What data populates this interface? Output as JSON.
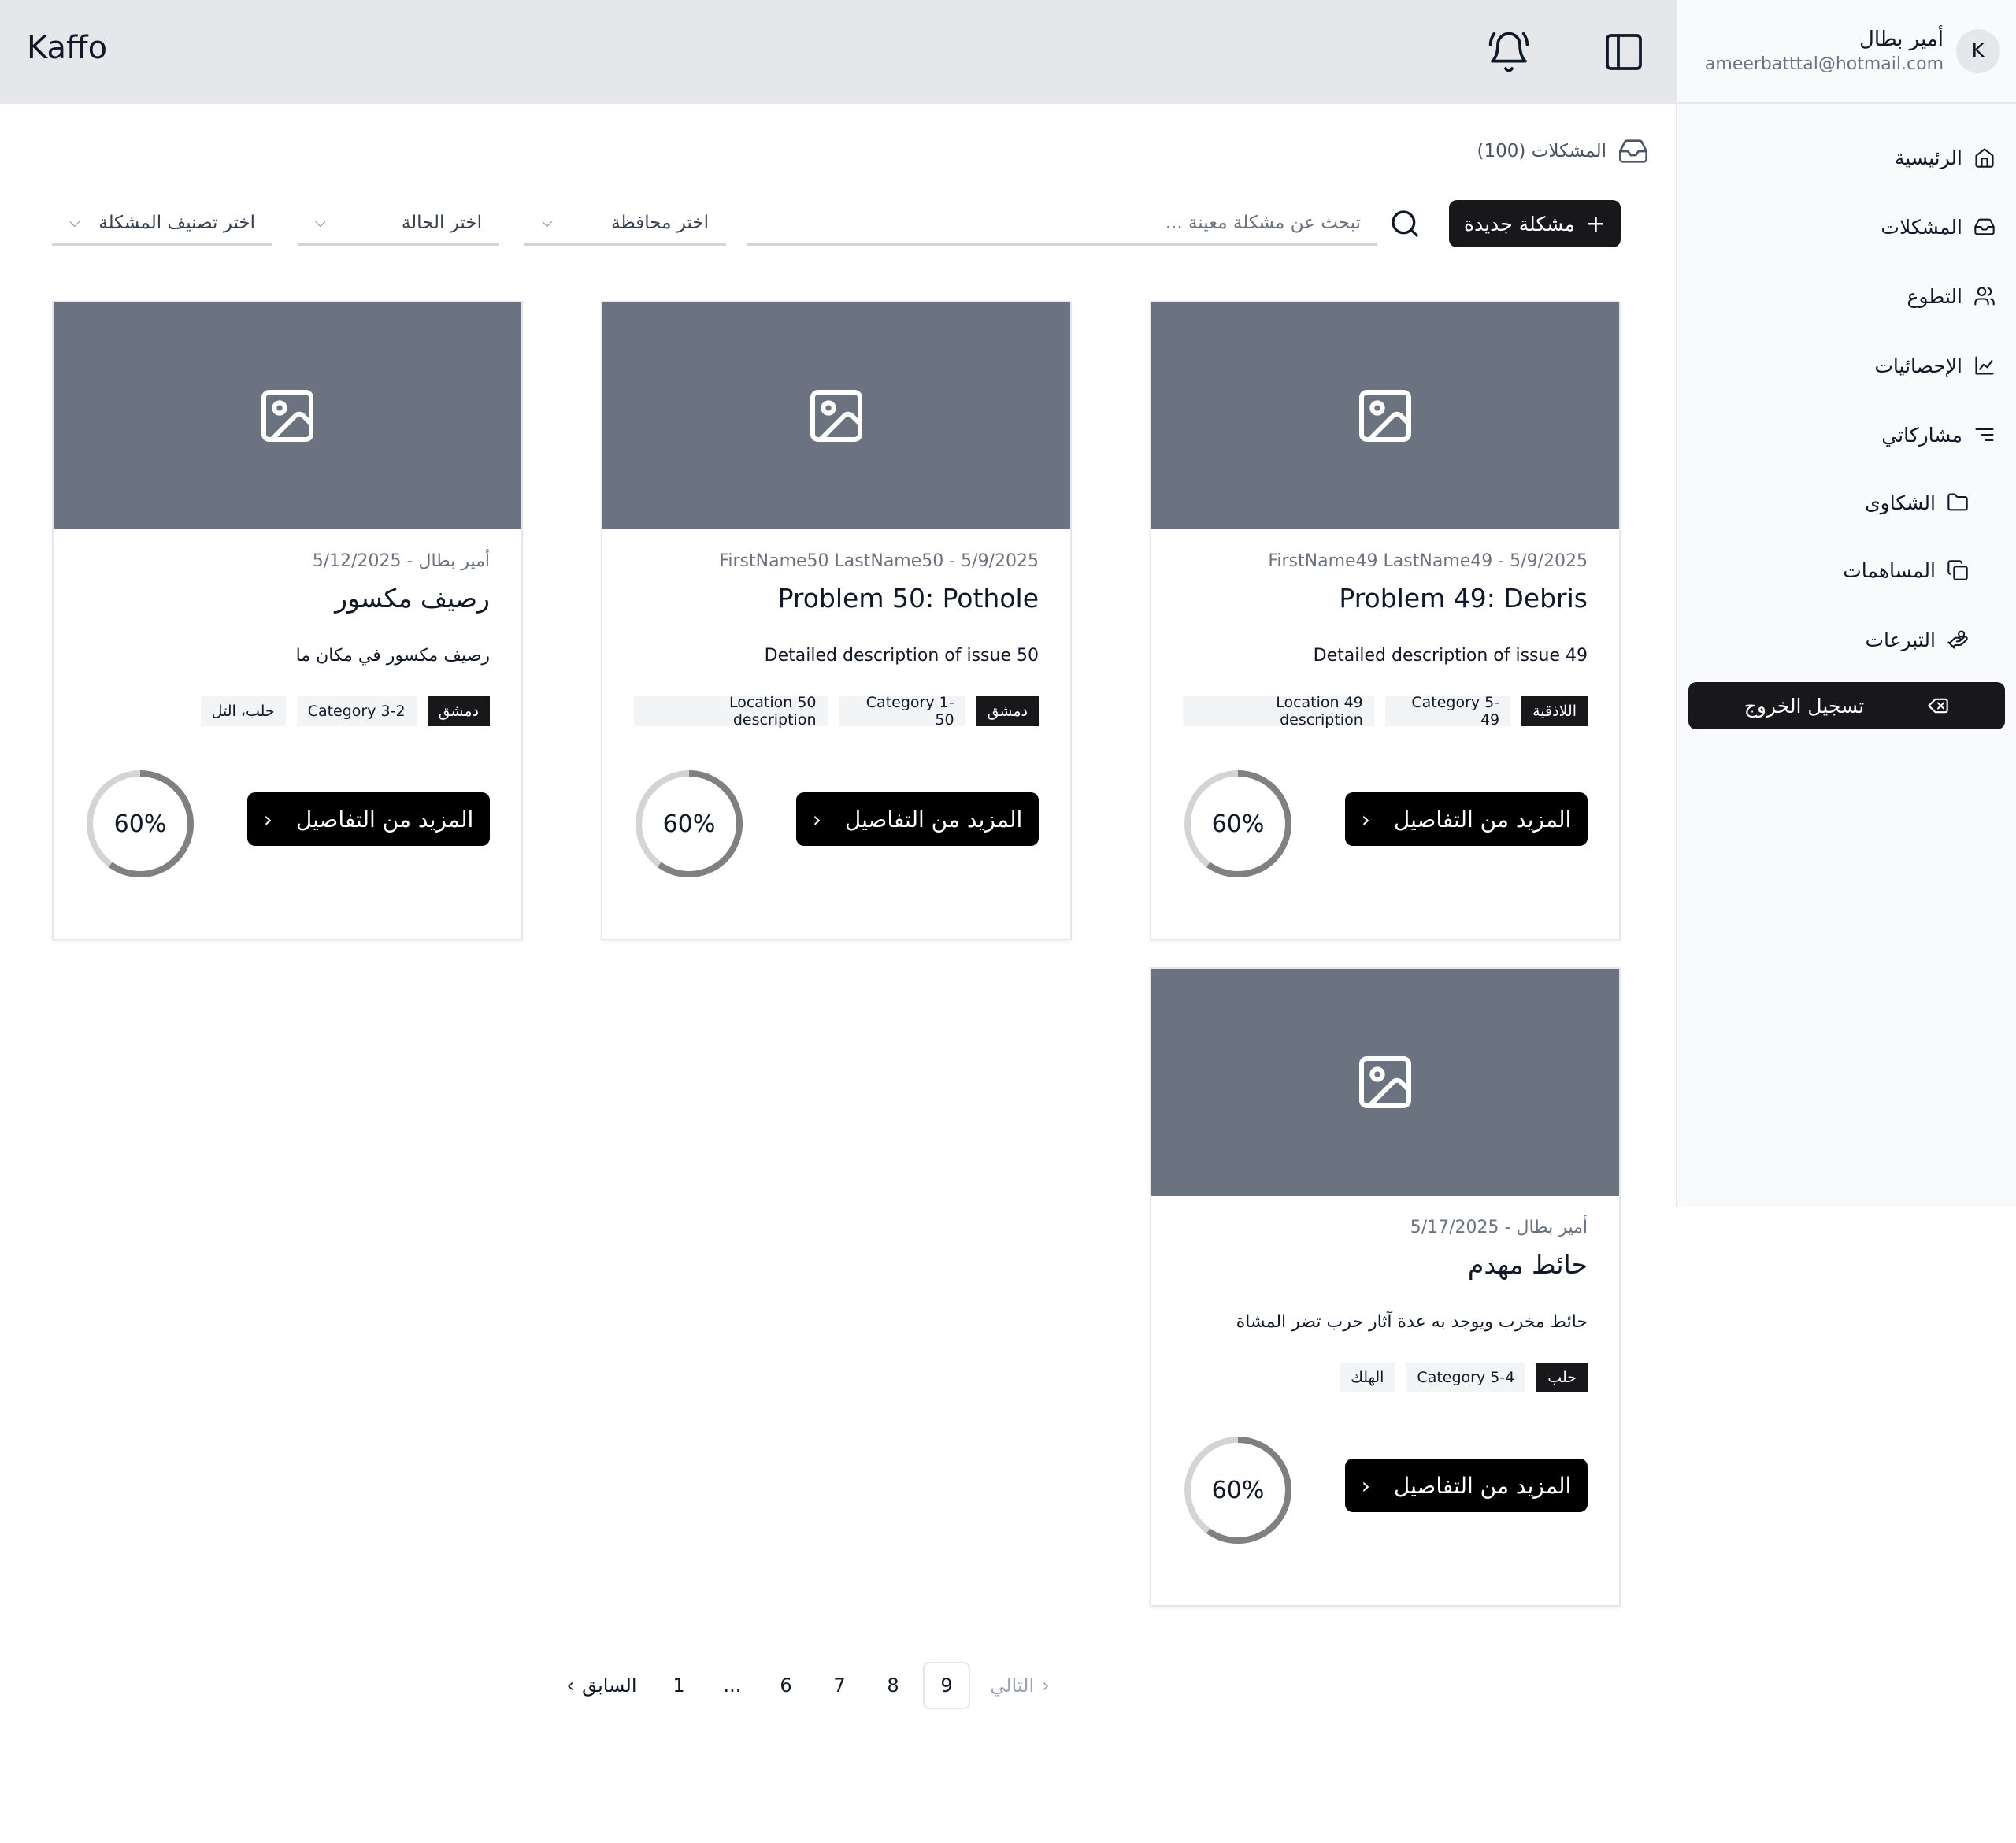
{
  "app": {
    "logo": "Kaffo"
  },
  "user": {
    "initial": "K",
    "name": "أمير بطال",
    "email": "ameerbatttal@hotmail.com"
  },
  "sidebar": {
    "items": [
      {
        "label": "الرئيسية",
        "icon": "home-icon"
      },
      {
        "label": "المشكلات",
        "icon": "inbox-icon"
      },
      {
        "label": "التطوع",
        "icon": "users-icon"
      },
      {
        "label": "الإحصائيات",
        "icon": "chart-icon"
      },
      {
        "label": "مشاركاتي",
        "icon": "list-icon"
      }
    ],
    "sub_items": [
      {
        "label": "الشكاوى",
        "icon": "folder-icon"
      },
      {
        "label": "المساهمات",
        "icon": "copy-icon"
      },
      {
        "label": "التبرعات",
        "icon": "donation-icon"
      }
    ],
    "logout": "تسجيل الخروج"
  },
  "page": {
    "title": "المشكلات (100)"
  },
  "toolbar": {
    "new_button": "مشكلة جديدة",
    "search_placeholder": "تبحث عن مشكلة معينة ...",
    "filter_governorate": "اختر محافظة",
    "filter_status": "اختر الحالة",
    "filter_category": "اختر تصنيف المشكلة"
  },
  "cards": [
    {
      "meta": "FirstName49 LastName49 - 5/9/2025",
      "title": "Problem 49: Debris",
      "description": "Detailed description of issue 49",
      "tags": [
        "اللاذقية",
        "Category 5-49",
        "Location 49 description"
      ],
      "button": "المزيد من التفاصيل",
      "progress": 60,
      "progress_label": "60%"
    },
    {
      "meta": "FirstName50 LastName50 - 5/9/2025",
      "title": "Problem 50: Pothole",
      "description": "Detailed description of issue 50",
      "tags": [
        "دمشق",
        "Category 1-50",
        "Location 50 description"
      ],
      "button": "المزيد من التفاصيل",
      "progress": 60,
      "progress_label": "60%"
    },
    {
      "meta": "أمير بطال - 5/12/2025",
      "title": "رصيف مكسور",
      "description": "رصيف مكسور في مكان ما",
      "tags": [
        "دمشق",
        "Category 3-2",
        "حلب، التل"
      ],
      "button": "المزيد من التفاصيل",
      "progress": 60,
      "progress_label": "60%"
    },
    {
      "meta": "أمير بطال - 5/17/2025",
      "title": "حائط مهدم",
      "description": "حائط مخرب ويوجد به عدة آثار حرب تضر المشاة",
      "tags": [
        "حلب",
        "Category 5-4",
        "الهلك"
      ],
      "button": "المزيد من التفاصيل",
      "progress": 60,
      "progress_label": "60%"
    }
  ],
  "pagination": {
    "prev": "السابق",
    "next": "التالي",
    "pages": [
      "1",
      "...",
      "6",
      "7",
      "8",
      "9"
    ],
    "current": "9"
  }
}
